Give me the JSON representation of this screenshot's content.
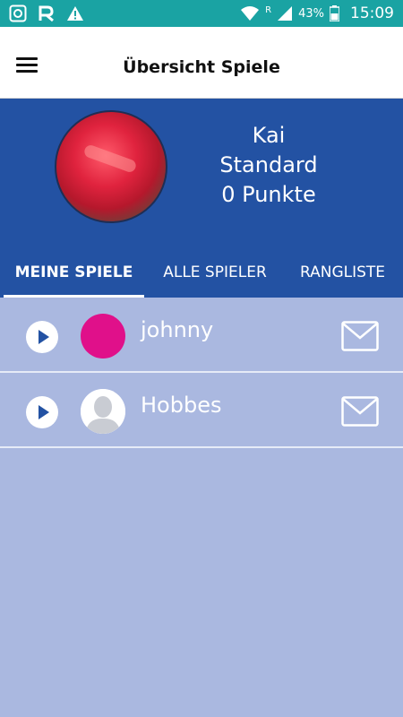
{
  "status_bar": {
    "time": "15:09",
    "battery_percent": "43%",
    "roaming_label": "R"
  },
  "app_bar": {
    "title": "Übersicht Spiele"
  },
  "profile": {
    "name": "Kai",
    "level": "Standard",
    "points": "0 Punkte"
  },
  "tabs": [
    {
      "label": "MEINE SPIELE",
      "active": true
    },
    {
      "label": "ALLE SPIELER",
      "active": false
    },
    {
      "label": "RANGLISTE",
      "active": false
    }
  ],
  "games": [
    {
      "player": "johnny",
      "avatar": "magenta-circle"
    },
    {
      "player": "Hobbes",
      "avatar": "default-silhouette"
    }
  ],
  "colors": {
    "status_bar": "#1aa3a3",
    "header_blue": "#2352a3",
    "list_background": "#aab8e0",
    "magenta": "#e0108a"
  }
}
